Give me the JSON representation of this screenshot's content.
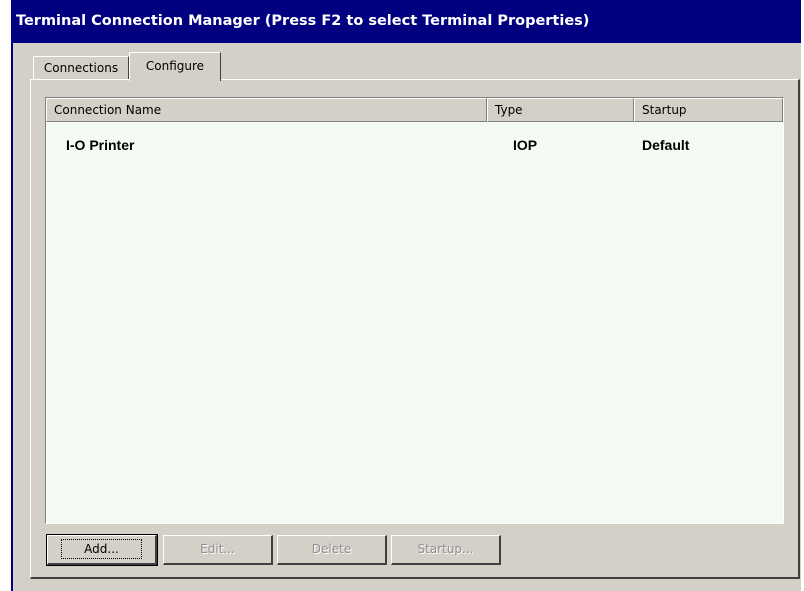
{
  "window": {
    "title": "Terminal Connection Manager (Press F2 to select Terminal Properties)"
  },
  "tabs": [
    {
      "label": "Connections",
      "selected": false
    },
    {
      "label": "Configure",
      "selected": true
    }
  ],
  "list": {
    "columns": [
      "Connection Name",
      "Type",
      "Startup"
    ],
    "rows": [
      {
        "name": "I-O Printer",
        "type": "IOP",
        "startup": "Default"
      }
    ]
  },
  "buttons": {
    "add": {
      "label": "Add...",
      "enabled": true
    },
    "edit": {
      "label": "Edit...",
      "enabled": false
    },
    "delete": {
      "label": "Delete",
      "enabled": false
    },
    "startup": {
      "label": "Startup...",
      "enabled": false
    }
  },
  "colors": {
    "titlebar": "#000080",
    "face": "#d4d0c8",
    "list_background": "#f5faf5"
  }
}
